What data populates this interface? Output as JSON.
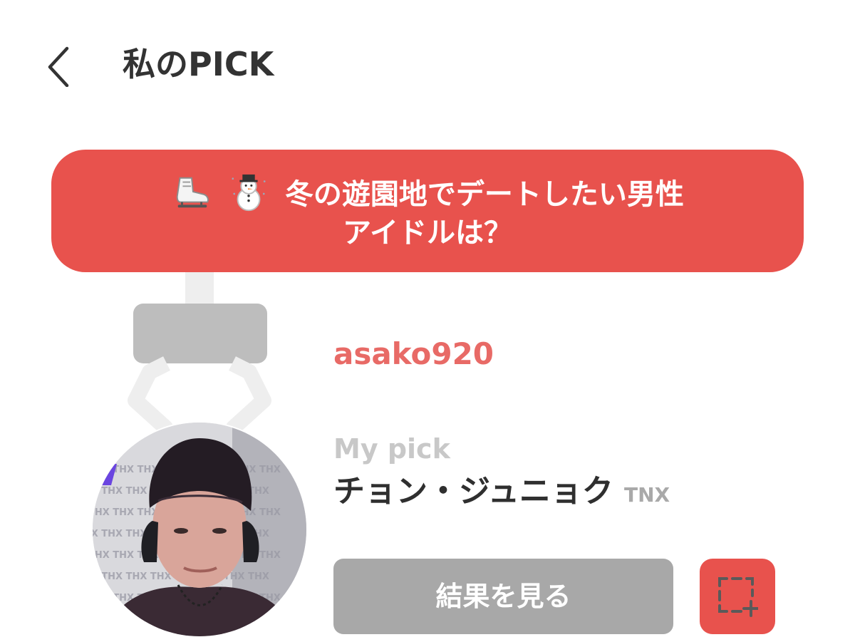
{
  "header": {
    "back_icon": "chevron-left-icon",
    "title": "私のPICK"
  },
  "question": {
    "icons": [
      "ice-skate-icon",
      "snowman-icon"
    ],
    "line1": "冬の遊園地でデートしたい男性",
    "line2": "アイドルは？",
    "background_color": "#e8524d"
  },
  "pick": {
    "username": "asako920",
    "caption": "My pick",
    "idol_name": "チョン・ジュニョク",
    "idol_group": "TNX",
    "avatar_text": "THX THX THX"
  },
  "actions": {
    "result_label": "結果を見る",
    "capture_icon": "screen-capture-icon"
  },
  "colors": {
    "accent": "#e8524d",
    "username": "#e86a66",
    "button_gray": "#a8a8a8",
    "claw_gray": "#bdbdbd"
  }
}
